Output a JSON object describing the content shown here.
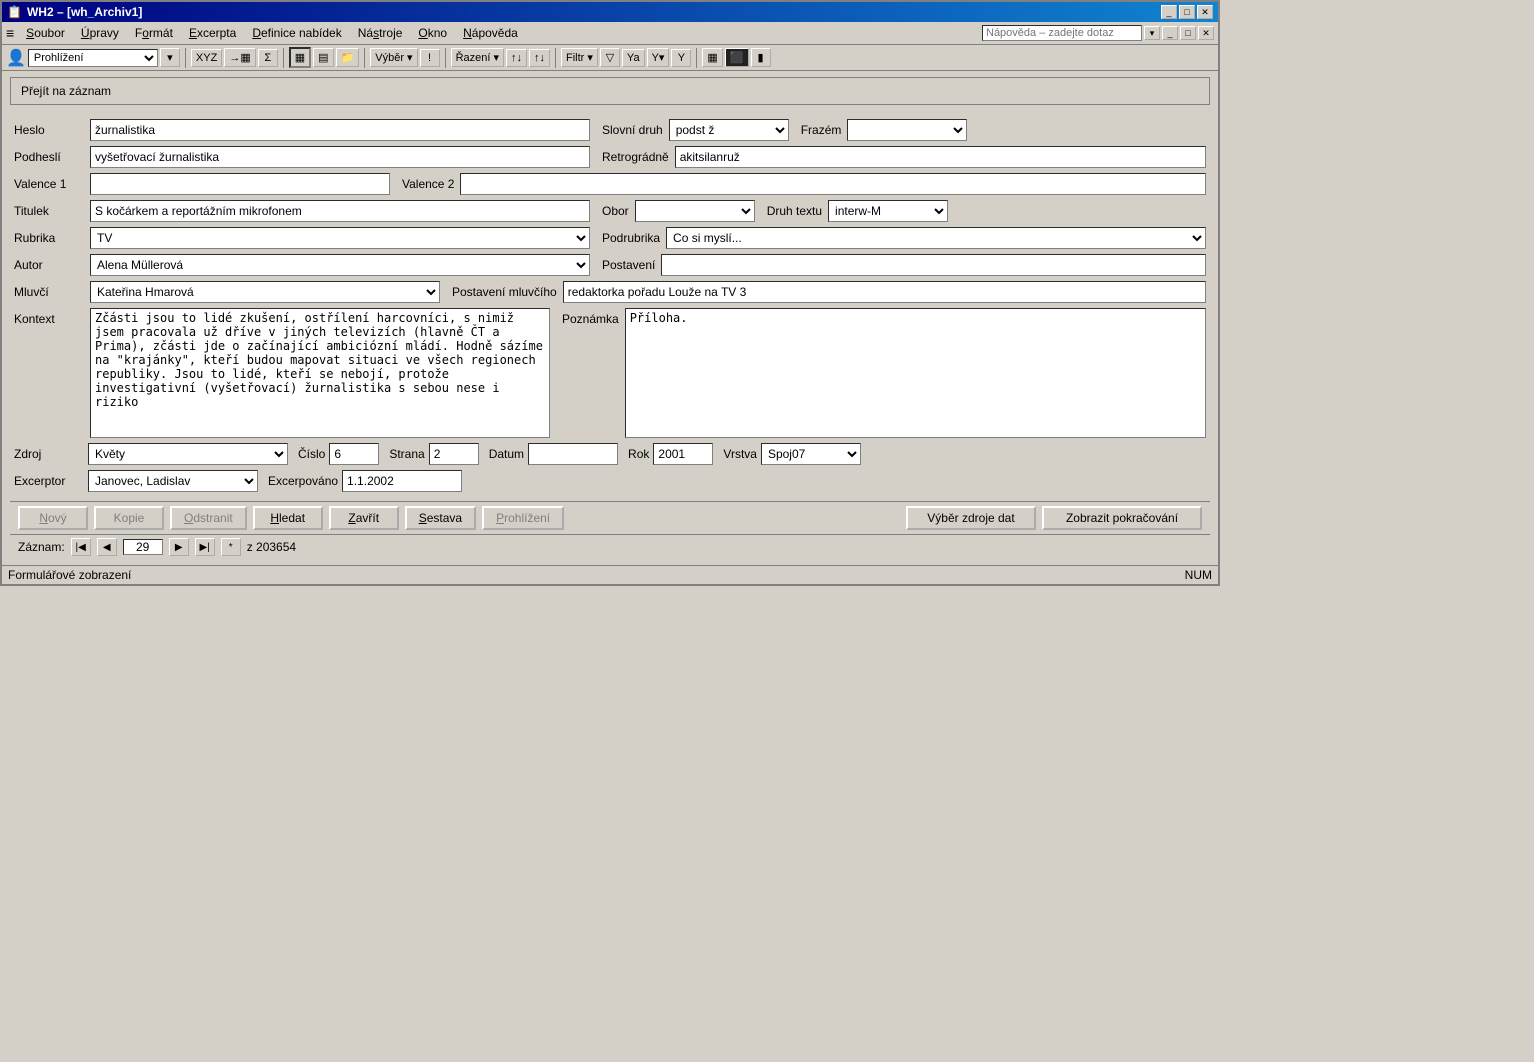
{
  "window": {
    "title": "WH2 – [wh_Archiv1]",
    "title_icon": "📋"
  },
  "title_buttons": {
    "minimize": "_",
    "maximize": "□",
    "close": "✕"
  },
  "menu": {
    "items": [
      {
        "label": "Soubor",
        "underline_index": 0
      },
      {
        "label": "Úpravy",
        "underline_index": 0
      },
      {
        "label": "Formát",
        "underline_index": 0
      },
      {
        "label": "Excerpta",
        "underline_index": 0
      },
      {
        "label": "Definice nabídek",
        "underline_index": 0
      },
      {
        "label": "Nástroje",
        "underline_index": 1
      },
      {
        "label": "Okno",
        "underline_index": 0
      },
      {
        "label": "Nápověda",
        "underline_index": 0
      }
    ],
    "help_placeholder": "Nápověda – zadejte dotaz"
  },
  "toolbar": {
    "view_label": "Prohlížení",
    "view_options": [
      "Prohlížení"
    ],
    "buttons": [
      "XYZ",
      "→▦",
      "Σ",
      "▦",
      "▤",
      "📁",
      "Výběr ▾",
      "!",
      "Řazení ▾",
      "↑↓",
      "↑↓",
      "Filtr ▾",
      "▽",
      "Ya",
      "Y▾",
      "Y",
      "▦",
      "⬛",
      "▮"
    ]
  },
  "goto": {
    "label": "Přejít na záznam"
  },
  "form": {
    "heslo_label": "Heslo",
    "heslo_value": "žurnalistika",
    "slovni_druh_label": "Slovní druh",
    "slovni_druh_value": "podst ž",
    "slovni_druh_options": [
      "podst ž"
    ],
    "frazem_label": "Frazém",
    "frazem_value": "",
    "podhesli_label": "Podheslí",
    "podhesli_value": "vyšetřovací žurnalistika",
    "retrogradne_label": "Retrográdně",
    "retrogradne_value": "akitsilanruž",
    "valence1_label": "Valence 1",
    "valence1_value": "",
    "valence2_label": "Valence 2",
    "valence2_value": "",
    "titulek_label": "Titulek",
    "titulek_value": "S kočárkem a reportážním mikrofonem",
    "obor_label": "Obor",
    "obor_value": "",
    "obor_options": [
      ""
    ],
    "druh_textu_label": "Druh textu",
    "druh_textu_value": "interw-M",
    "druh_textu_options": [
      "interw-M"
    ],
    "rubrika_label": "Rubrika",
    "rubrika_value": "TV",
    "rubrika_options": [
      "TV"
    ],
    "podrubrika_label": "Podrubrika",
    "podrubrika_value": "Co si myslí...",
    "podrubrika_options": [
      "Co si myslí..."
    ],
    "autor_label": "Autor",
    "autor_value": "Alena Müllerová",
    "autor_options": [
      "Alena Müllerová"
    ],
    "postaveni_label": "Postavení",
    "postaveni_value": "",
    "mluvcí_label": "Mluvčí",
    "mluvcí_value": "Kateřina Hmarová",
    "mluvcí_options": [
      "Kateřina Hmarová"
    ],
    "postaveni_mluvcího_label": "Postavení mluvčího",
    "postaveni_mluvcího_value": "redaktorka pořadu Louže na TV 3",
    "kontext_label": "Kontext",
    "kontext_value": "Zčásti jsou to lidé zkušení, ostřílení harcovníci, s nimiž jsem pracovala už dříve v jiných televizích (hlavně ČT a Prima), zčásti jde o začínající ambiciózní mládí. Hodně sázíme na \"krajánky\", kteří budou mapovat situaci ve všech regionech republiky. Jsou to lidé, kteří se nebojí, protože investigativní (vyšetřovací) žurnalistika s sebou nese i riziko",
    "poznamka_label": "Poznámka",
    "poznamka_value": "Příloha.",
    "zdroj_label": "Zdroj",
    "zdroj_value": "Květy",
    "zdroj_options": [
      "Květy"
    ],
    "cislo_label": "Číslo",
    "cislo_value": "6",
    "strana_label": "Strana",
    "strana_value": "2",
    "datum_label": "Datum",
    "datum_value": "",
    "rok_label": "Rok",
    "rok_value": "2001",
    "vrstva_label": "Vrstva",
    "vrstva_value": "Spoj07",
    "vrstva_options": [
      "Spoj07"
    ],
    "excerptor_label": "Excerptor",
    "excerptor_value": "Janovec, Ladislav",
    "excerptor_options": [
      "Janovec, Ladislav"
    ],
    "excerpovano_label": "Excerpováno",
    "excerpovano_value": "1.1.2002"
  },
  "buttons": {
    "novy": "Nový",
    "kopie": "Kopie",
    "odstranit": "Odstranit",
    "hledat": "Hledat",
    "zavrit": "Zavřít",
    "sestava": "Sestava",
    "prohlizeni": "Prohlížení",
    "vyber_zdroje": "Výběr zdroje dat",
    "zobrazit": "Zobrazit pokračování"
  },
  "navigation": {
    "záznam_label": "Záznam:",
    "current": "29",
    "total_label": "z 203654"
  },
  "status": {
    "left": "Formulářové zobrazení",
    "right": "NUM"
  }
}
